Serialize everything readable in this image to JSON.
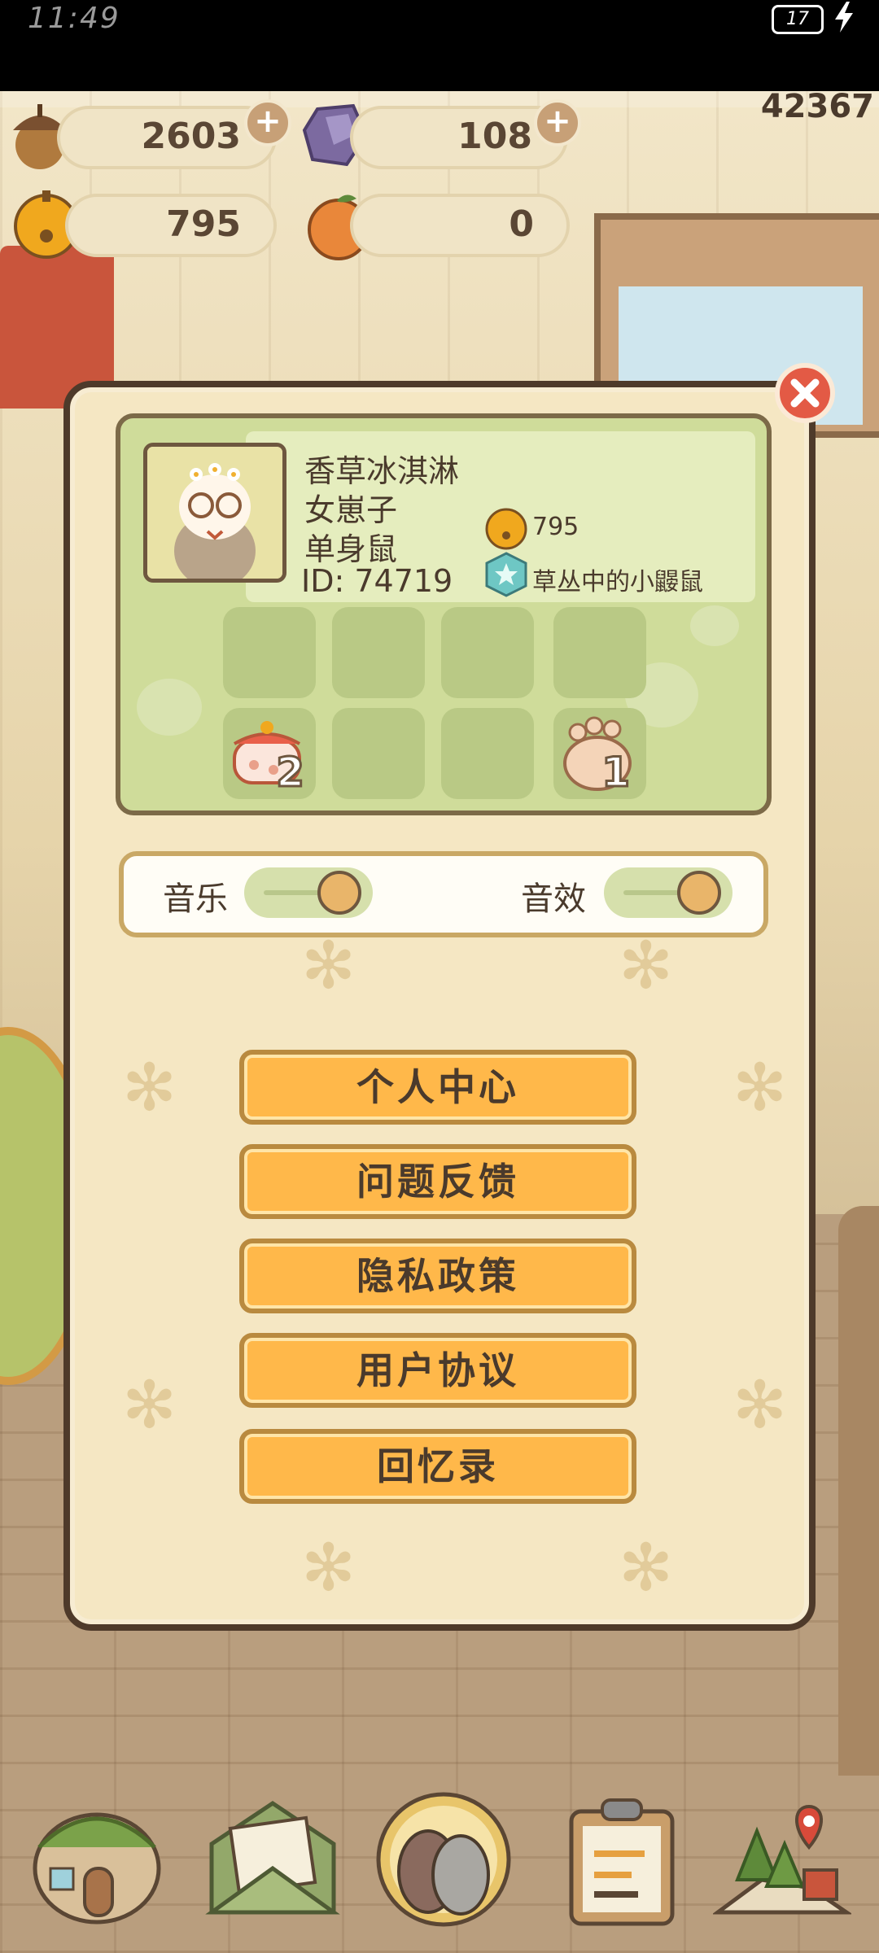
{
  "status_bar": {
    "time": "11:49",
    "battery": "17"
  },
  "resources": {
    "acorns": "2603",
    "gems": "108",
    "bells": "795",
    "oranges": "0",
    "score": "42367"
  },
  "profile": {
    "name": "香草冰淇淋",
    "title": "女崽子",
    "status": "单身鼠",
    "id": "ID: 74719",
    "bells": "795",
    "rank": "草丛中的小鼹鼠"
  },
  "items": [
    {
      "icon": "cooking-pot-icon",
      "count": "2"
    },
    {
      "icon": "paw-cushion-icon",
      "count": "1"
    }
  ],
  "settings": {
    "music_label": "音乐",
    "sfx_label": "音效",
    "music_on": true,
    "sfx_on": true
  },
  "menu": [
    {
      "label": "个人中心"
    },
    {
      "label": "问题反馈"
    },
    {
      "label": "隐私政策"
    },
    {
      "label": "用户协议"
    },
    {
      "label": "回忆录"
    }
  ]
}
